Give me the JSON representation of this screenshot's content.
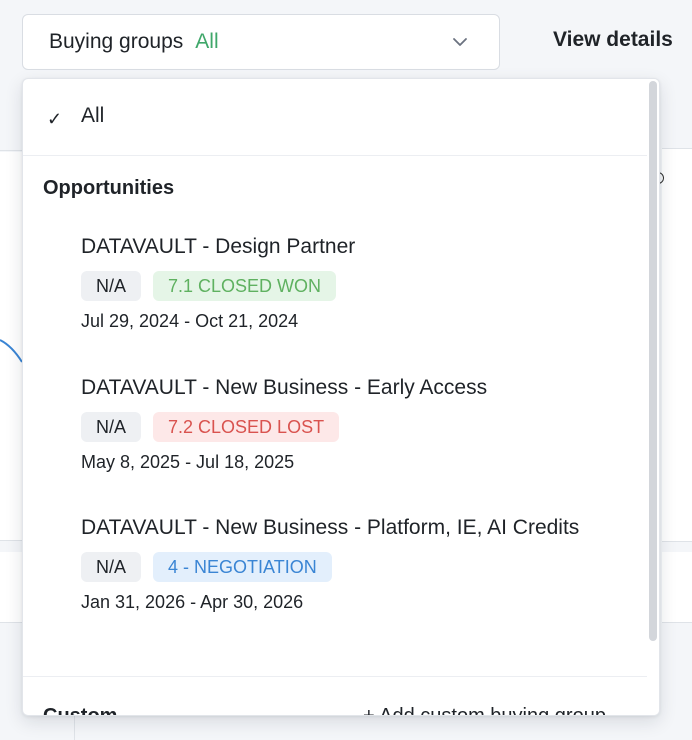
{
  "filter": {
    "label": "Buying groups",
    "value": "All",
    "value_color": "#3fa76a"
  },
  "view_details_label": "View details",
  "menu": {
    "all_option": {
      "check": "✓",
      "label": "All"
    },
    "opportunities_title": "Opportunities",
    "opportunities": [
      {
        "name": "DATAVAULT - Design Partner",
        "amount": "N/A",
        "stage": "7.1 CLOSED WON",
        "stage_color": "#5fb160",
        "dates": "Jul 29, 2024 - Oct 21, 2024"
      },
      {
        "name": "DATAVAULT - New Business - Early Access",
        "amount": "N/A",
        "stage": "7.2 CLOSED LOST",
        "stage_color": "#d9534f",
        "dates": "May 8, 2025 - Jul 18, 2025"
      },
      {
        "name": "DATAVAULT - New Business - Platform, IE, AI Credits",
        "amount": "N/A",
        "stage": "4 - NEGOTIATION",
        "stage_color": "#3a85d4",
        "dates": "Jan 31, 2026 - Apr 30, 2026"
      }
    ],
    "custom_title": "Custom",
    "add_custom_label": "+ Add custom buying group"
  }
}
